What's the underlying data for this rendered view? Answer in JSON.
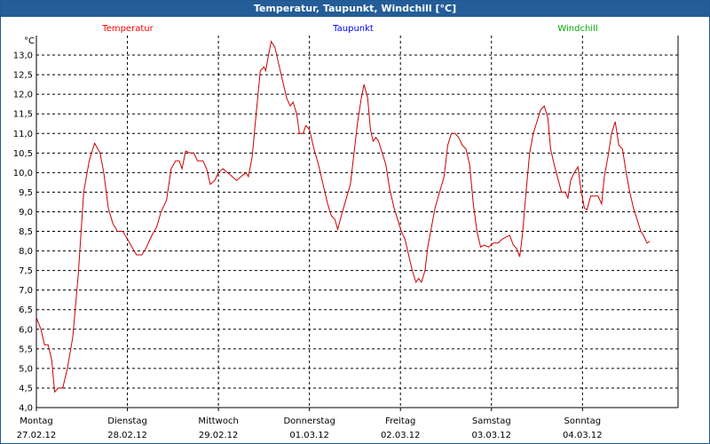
{
  "window": {
    "title": "Temperatur, Taupunkt, Windchill [°C]"
  },
  "chart_data": {
    "type": "line",
    "title": "Temperatur, Taupunkt, Windchill [°C]",
    "ylabel": "°C",
    "ylim": [
      4.0,
      13.5
    ],
    "yticks": [
      "4,0",
      "4,5",
      "5,0",
      "5,5",
      "6,0",
      "6,5",
      "7,0",
      "7,5",
      "8,0",
      "8,5",
      "9,0",
      "9,5",
      "10,0",
      "10,5",
      "11,0",
      "11,5",
      "12,0",
      "12,5",
      "13,0"
    ],
    "grid": true,
    "legend_placement": "top",
    "legend": [
      {
        "name": "Temperatur",
        "color": "#ff0000"
      },
      {
        "name": "Taupunkt",
        "color": "#0000ff"
      },
      {
        "name": "Windchill",
        "color": "#00aa00"
      }
    ],
    "x_days": [
      {
        "day": "Montag",
        "date": "27.02.12"
      },
      {
        "day": "Dienstag",
        "date": "28.02.12"
      },
      {
        "day": "Mittwoch",
        "date": "29.02.12"
      },
      {
        "day": "Donnerstag",
        "date": "01.03.12"
      },
      {
        "day": "Freitag",
        "date": "02.03.12"
      },
      {
        "day": "Samstag",
        "date": "03.03.12"
      },
      {
        "day": "Sonntag",
        "date": "04.03.12"
      }
    ],
    "xlim": [
      0,
      7.05
    ],
    "series": [
      {
        "name": "Temperatur",
        "color": "#cc0000",
        "points": [
          [
            0.0,
            6.3
          ],
          [
            0.05,
            6.0
          ],
          [
            0.09,
            5.6
          ],
          [
            0.13,
            5.6
          ],
          [
            0.17,
            5.2
          ],
          [
            0.2,
            4.4
          ],
          [
            0.24,
            4.5
          ],
          [
            0.29,
            4.5
          ],
          [
            0.34,
            5.0
          ],
          [
            0.4,
            5.8
          ],
          [
            0.46,
            7.4
          ],
          [
            0.52,
            9.5
          ],
          [
            0.58,
            10.3
          ],
          [
            0.64,
            10.75
          ],
          [
            0.7,
            10.5
          ],
          [
            0.74,
            10.0
          ],
          [
            0.79,
            9.1
          ],
          [
            0.84,
            8.7
          ],
          [
            0.89,
            8.5
          ],
          [
            0.95,
            8.5
          ],
          [
            1.0,
            8.3
          ],
          [
            1.05,
            8.1
          ],
          [
            1.1,
            7.9
          ],
          [
            1.16,
            7.9
          ],
          [
            1.21,
            8.1
          ],
          [
            1.27,
            8.4
          ],
          [
            1.32,
            8.6
          ],
          [
            1.37,
            9.0
          ],
          [
            1.43,
            9.3
          ],
          [
            1.48,
            10.1
          ],
          [
            1.53,
            10.3
          ],
          [
            1.57,
            10.3
          ],
          [
            1.6,
            10.1
          ],
          [
            1.64,
            10.55
          ],
          [
            1.69,
            10.5
          ],
          [
            1.73,
            10.5
          ],
          [
            1.77,
            10.3
          ],
          [
            1.83,
            10.3
          ],
          [
            1.87,
            10.1
          ],
          [
            1.91,
            9.7
          ],
          [
            1.96,
            9.8
          ],
          [
            2.0,
            10.0
          ],
          [
            2.05,
            10.1
          ],
          [
            2.1,
            10.0
          ],
          [
            2.15,
            9.9
          ],
          [
            2.2,
            9.8
          ],
          [
            2.25,
            9.9
          ],
          [
            2.3,
            10.0
          ],
          [
            2.33,
            9.9
          ],
          [
            2.37,
            10.4
          ],
          [
            2.41,
            11.4
          ],
          [
            2.46,
            12.6
          ],
          [
            2.5,
            12.7
          ],
          [
            2.52,
            12.6
          ],
          [
            2.55,
            13.0
          ],
          [
            2.58,
            13.35
          ],
          [
            2.62,
            13.2
          ],
          [
            2.67,
            12.7
          ],
          [
            2.71,
            12.3
          ],
          [
            2.75,
            11.9
          ],
          [
            2.79,
            11.7
          ],
          [
            2.82,
            11.8
          ],
          [
            2.86,
            11.5
          ],
          [
            2.89,
            11.0
          ],
          [
            2.93,
            11.0
          ],
          [
            2.96,
            11.2
          ],
          [
            3.0,
            11.1
          ],
          [
            3.05,
            10.6
          ],
          [
            3.1,
            10.2
          ],
          [
            3.15,
            9.7
          ],
          [
            3.2,
            9.2
          ],
          [
            3.24,
            8.9
          ],
          [
            3.28,
            8.8
          ],
          [
            3.31,
            8.55
          ],
          [
            3.35,
            8.9
          ],
          [
            3.4,
            9.3
          ],
          [
            3.45,
            9.7
          ],
          [
            3.49,
            10.5
          ],
          [
            3.53,
            11.3
          ],
          [
            3.57,
            11.9
          ],
          [
            3.6,
            12.25
          ],
          [
            3.64,
            11.9
          ],
          [
            3.67,
            11.1
          ],
          [
            3.7,
            10.8
          ],
          [
            3.73,
            10.9
          ],
          [
            3.76,
            10.8
          ],
          [
            3.8,
            10.5
          ],
          [
            3.84,
            10.2
          ],
          [
            3.88,
            9.6
          ],
          [
            3.93,
            9.1
          ],
          [
            3.97,
            8.8
          ],
          [
            4.01,
            8.5
          ],
          [
            4.05,
            8.3
          ],
          [
            4.09,
            7.9
          ],
          [
            4.13,
            7.5
          ],
          [
            4.17,
            7.2
          ],
          [
            4.2,
            7.3
          ],
          [
            4.23,
            7.2
          ],
          [
            4.27,
            7.5
          ],
          [
            4.3,
            8.1
          ],
          [
            4.34,
            8.6
          ],
          [
            4.38,
            9.1
          ],
          [
            4.43,
            9.5
          ],
          [
            4.48,
            9.9
          ],
          [
            4.52,
            10.7
          ],
          [
            4.56,
            11.0
          ],
          [
            4.6,
            11.0
          ],
          [
            4.64,
            10.9
          ],
          [
            4.68,
            10.7
          ],
          [
            4.72,
            10.6
          ],
          [
            4.76,
            10.2
          ],
          [
            4.8,
            9.2
          ],
          [
            4.84,
            8.5
          ],
          [
            4.88,
            8.1
          ],
          [
            4.92,
            8.15
          ],
          [
            4.97,
            8.1
          ],
          [
            5.02,
            8.2
          ],
          [
            5.07,
            8.2
          ],
          [
            5.12,
            8.3
          ],
          [
            5.16,
            8.35
          ],
          [
            5.2,
            8.4
          ],
          [
            5.24,
            8.15
          ],
          [
            5.28,
            8.05
          ],
          [
            5.31,
            7.85
          ],
          [
            5.34,
            8.4
          ],
          [
            5.38,
            9.5
          ],
          [
            5.42,
            10.5
          ],
          [
            5.46,
            11.0
          ],
          [
            5.5,
            11.3
          ],
          [
            5.54,
            11.6
          ],
          [
            5.58,
            11.7
          ],
          [
            5.62,
            11.4
          ],
          [
            5.65,
            10.6
          ],
          [
            5.69,
            10.2
          ],
          [
            5.73,
            9.85
          ],
          [
            5.77,
            9.5
          ],
          [
            5.81,
            9.5
          ],
          [
            5.84,
            9.35
          ],
          [
            5.87,
            9.8
          ],
          [
            5.91,
            10.0
          ],
          [
            5.95,
            10.15
          ],
          [
            5.98,
            9.6
          ],
          [
            6.02,
            9.1
          ],
          [
            6.05,
            9.05
          ],
          [
            6.09,
            9.4
          ],
          [
            6.13,
            9.4
          ],
          [
            6.17,
            9.4
          ],
          [
            6.21,
            9.2
          ],
          [
            6.24,
            9.9
          ],
          [
            6.28,
            10.4
          ],
          [
            6.32,
            11.0
          ],
          [
            6.36,
            11.3
          ],
          [
            6.4,
            10.7
          ],
          [
            6.44,
            10.6
          ],
          [
            6.48,
            10.0
          ],
          [
            6.52,
            9.5
          ],
          [
            6.56,
            9.1
          ],
          [
            6.6,
            8.8
          ],
          [
            6.64,
            8.5
          ],
          [
            6.67,
            8.4
          ],
          [
            6.71,
            8.2
          ],
          [
            6.74,
            8.25
          ]
        ]
      }
    ]
  }
}
